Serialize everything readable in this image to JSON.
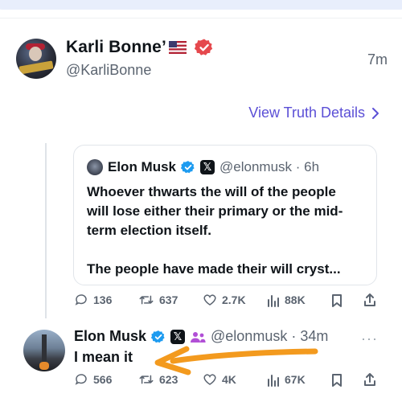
{
  "post": {
    "author_name": "Karli Bonne’",
    "author_handle": "@KarliBonne",
    "time": "7m",
    "flag_icon": "us-flag-icon",
    "verified_icon": "red-verified-badge-icon",
    "view_details": "View Truth Details",
    "view_details_icon": "chevron-right-icon"
  },
  "quote": {
    "author_name": "Elon Musk",
    "handle_time": "@elonmusk · 6h",
    "lines_para1": [
      "Whoever thwarts the will of the people",
      "will lose either their primary or the mid-",
      "term election itself."
    ],
    "line_para2": "The people have made their will cryst..."
  },
  "quote_actions": {
    "replies": "136",
    "retweets": "637",
    "likes": "2.7K",
    "views": "88K"
  },
  "reply": {
    "author_name": "Elon Musk",
    "handle_time": "@elonmusk · 34m",
    "text": "I mean it",
    "more": "···"
  },
  "reply_actions": {
    "replies": "566",
    "retweets": "623",
    "likes": "4K",
    "views": "67K"
  },
  "colors": {
    "accent_link": "#5b4fd6",
    "verified_blue": "#1d9bf0",
    "verified_red": "#e5484d",
    "annotation_arrow": "#f39a1e"
  }
}
